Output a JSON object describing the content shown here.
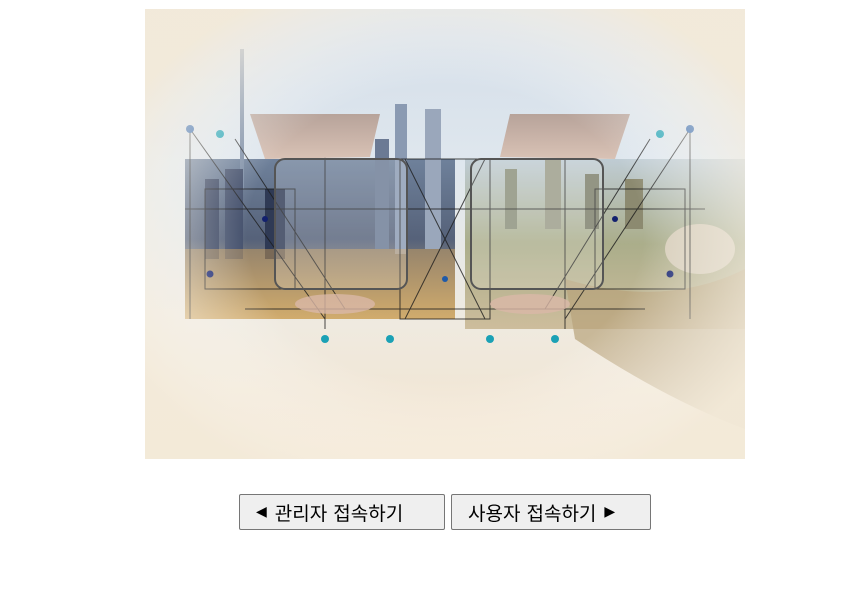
{
  "hero": {
    "alt": "city network hands image"
  },
  "buttons": {
    "admin_label": "관리자 접속하기",
    "admin_icon": "◀",
    "user_label": "사용자 접속하기",
    "user_icon": "▶"
  },
  "colors": {
    "button_bg": "#efefef",
    "button_border": "#767676"
  }
}
